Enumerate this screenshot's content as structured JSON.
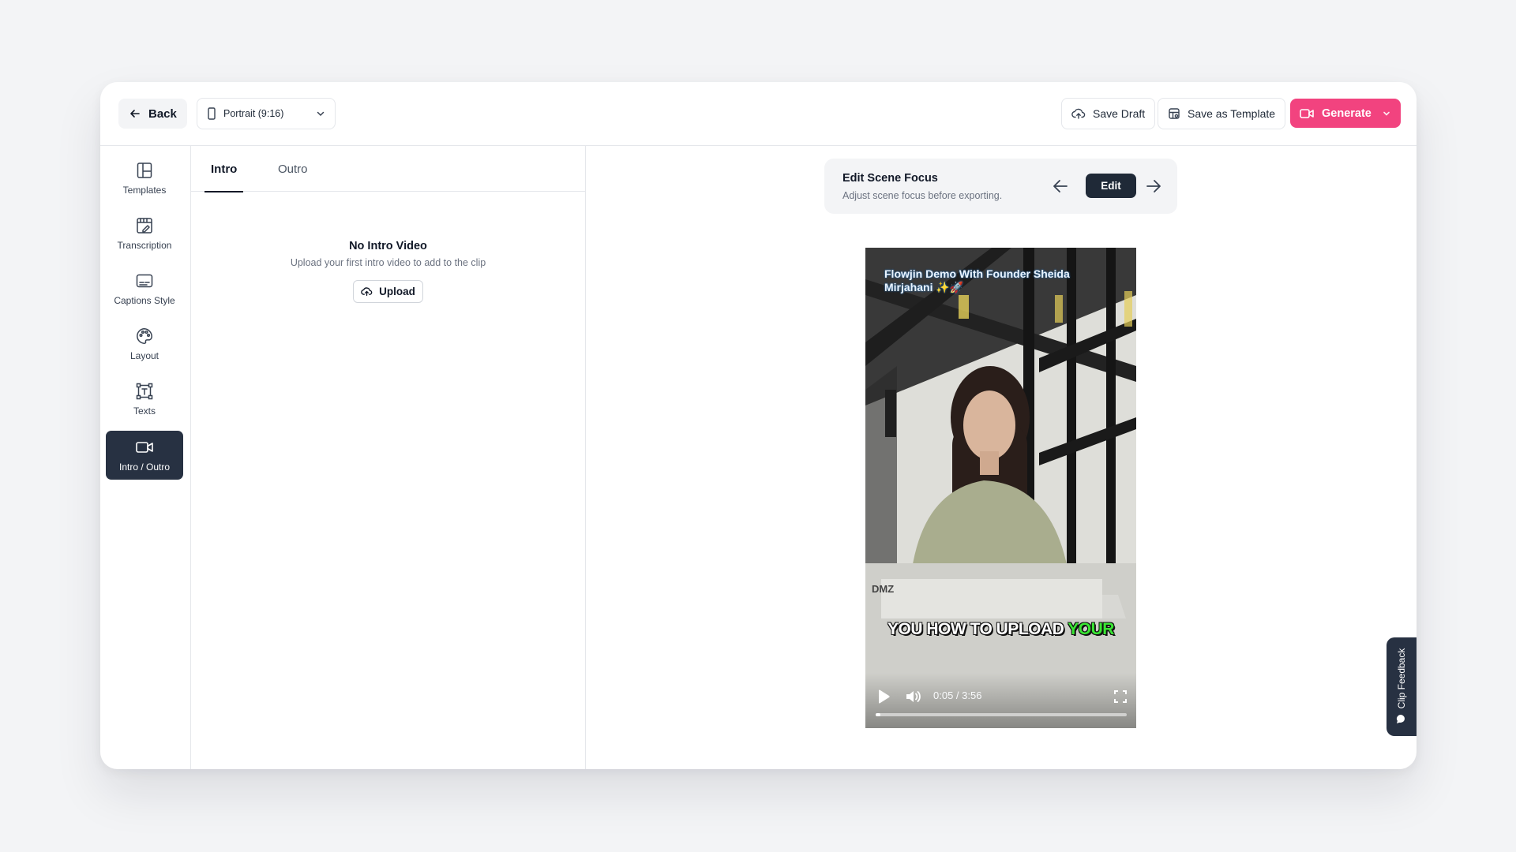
{
  "topbar": {
    "back_label": "Back",
    "aspect_label": "Portrait (9:16)",
    "save_draft_label": "Save Draft",
    "save_template_label": "Save as Template",
    "generate_label": "Generate"
  },
  "sidebar": {
    "items": [
      {
        "label": "Templates",
        "icon": "templates-icon"
      },
      {
        "label": "Transcription",
        "icon": "transcription-icon"
      },
      {
        "label": "Captions Style",
        "icon": "captions-icon"
      },
      {
        "label": "Layout",
        "icon": "palette-icon"
      },
      {
        "label": "Texts",
        "icon": "text-box-icon"
      },
      {
        "label": "Intro / Outro",
        "icon": "video-camera-icon",
        "active": true
      }
    ]
  },
  "panel": {
    "tabs": [
      {
        "label": "Intro",
        "active": true
      },
      {
        "label": "Outro",
        "active": false
      }
    ],
    "empty_title": "No Intro Video",
    "empty_subtitle": "Upload your first intro video to add to the clip",
    "upload_label": "Upload"
  },
  "scene_focus": {
    "title": "Edit Scene Focus",
    "subtitle": "Adjust scene focus before exporting.",
    "edit_label": "Edit"
  },
  "video": {
    "overlay_title": "Flowjin Demo With Founder Sheida Mirjahani ✨🚀",
    "caption_prefix": "YOU HOW TO UPLOAD",
    "caption_highlight": "YOUR",
    "time": "0:05 / 3:56",
    "progress": 0.02
  },
  "feedback_label": "Clip Feedback",
  "colors": {
    "brand": "#f2437f",
    "active_rail": "#273142",
    "caption_highlight": "#39e633"
  }
}
